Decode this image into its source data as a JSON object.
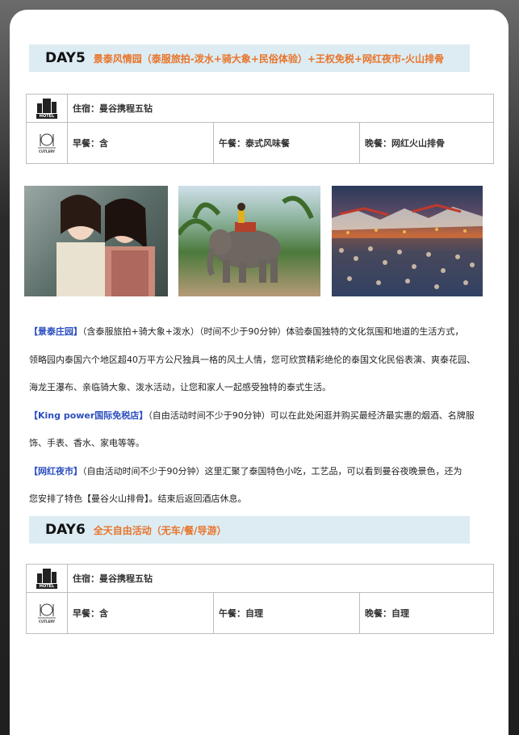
{
  "day5": {
    "label": "DAY5",
    "title": "景泰风情园（泰服旅拍-泼水+骑大象+民俗体验）+王权免税+网红夜市-火山排骨",
    "hotel": "住宿：曼谷携程五钻",
    "breakfast": "早餐：含",
    "lunch": "午餐：泰式风味餐",
    "dinner": "晚餐：网红火山排骨"
  },
  "icons": {
    "hotel_text": "HOTEL",
    "cutlery_text": "CUTLERY"
  },
  "paragraphs": {
    "p1_hl": "【景泰庄园】",
    "p1_text": "（含泰服旅拍+骑大象+泼水）（时间不少于90分钟）体验泰国独特的文化氛围和地道的生活方式，",
    "p1_line2": "领略园内泰国六个地区超40万平方公尺独具一格的风土人情，您可欣赏精彩绝伦的泰国文化民俗表演、爽泰花园、",
    "p1_line3": "海龙王瀑布、亲临骑大象、泼水活动，让您和家人一起感受独特的泰式生活。",
    "p2_hl": "【King power国际免税店】",
    "p2_text": "（自由活动时间不少于90分钟）可以在此处闲逛并购买最经济最实惠的烟酒、名牌服",
    "p2_line2": "饰、手表、香水、家电等等。",
    "p3_hl": "【网红夜市】",
    "p3_text": "（自由活动时间不少于90分钟）这里汇聚了泰国特色小吃，工艺品，可以看到曼谷夜晚景色，还为",
    "p3_line2": "您安排了特色【曼谷火山排骨】。结束后返回酒店休息。"
  },
  "day6": {
    "label": "DAY6",
    "title": "全天自由活动（无车/餐/导游）",
    "hotel": "住宿：曼谷携程五钻",
    "breakfast": "早餐：含",
    "lunch": "午餐：自理",
    "dinner": "晚餐：自理"
  }
}
